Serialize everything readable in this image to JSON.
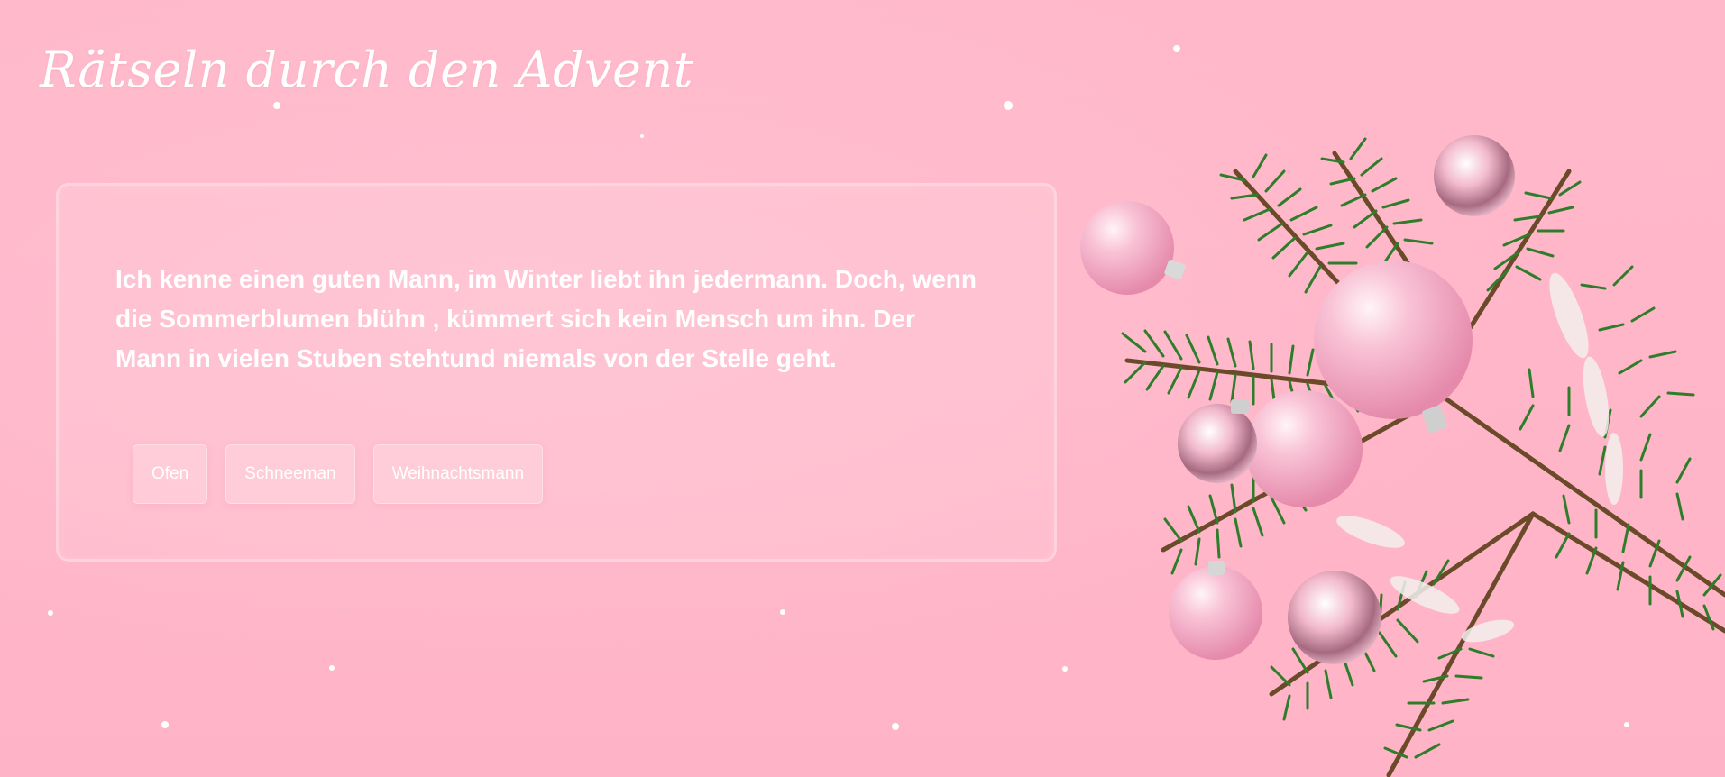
{
  "page": {
    "title": "Rätseln durch den Advent"
  },
  "riddle": {
    "text": "Ich kenne einen guten Mann, im Winter liebt ihn jedermann. Doch, wenn die Sommerblumen blühn , kümmert sich kein Mensch um ihn. Der Mann in vielen Stuben stehtund niemals von der Stelle geht.",
    "answers": [
      {
        "label": "Ofen"
      },
      {
        "label": "Schneeman"
      },
      {
        "label": "Weihnachtsmann"
      }
    ]
  },
  "decoration": {
    "image": "fir-branch-with-pink-christmas-baubles",
    "colors": {
      "background": "#ffb6c9",
      "fir_green": "#2f7d2a",
      "bauble_pink": "#f7a9c4"
    }
  }
}
